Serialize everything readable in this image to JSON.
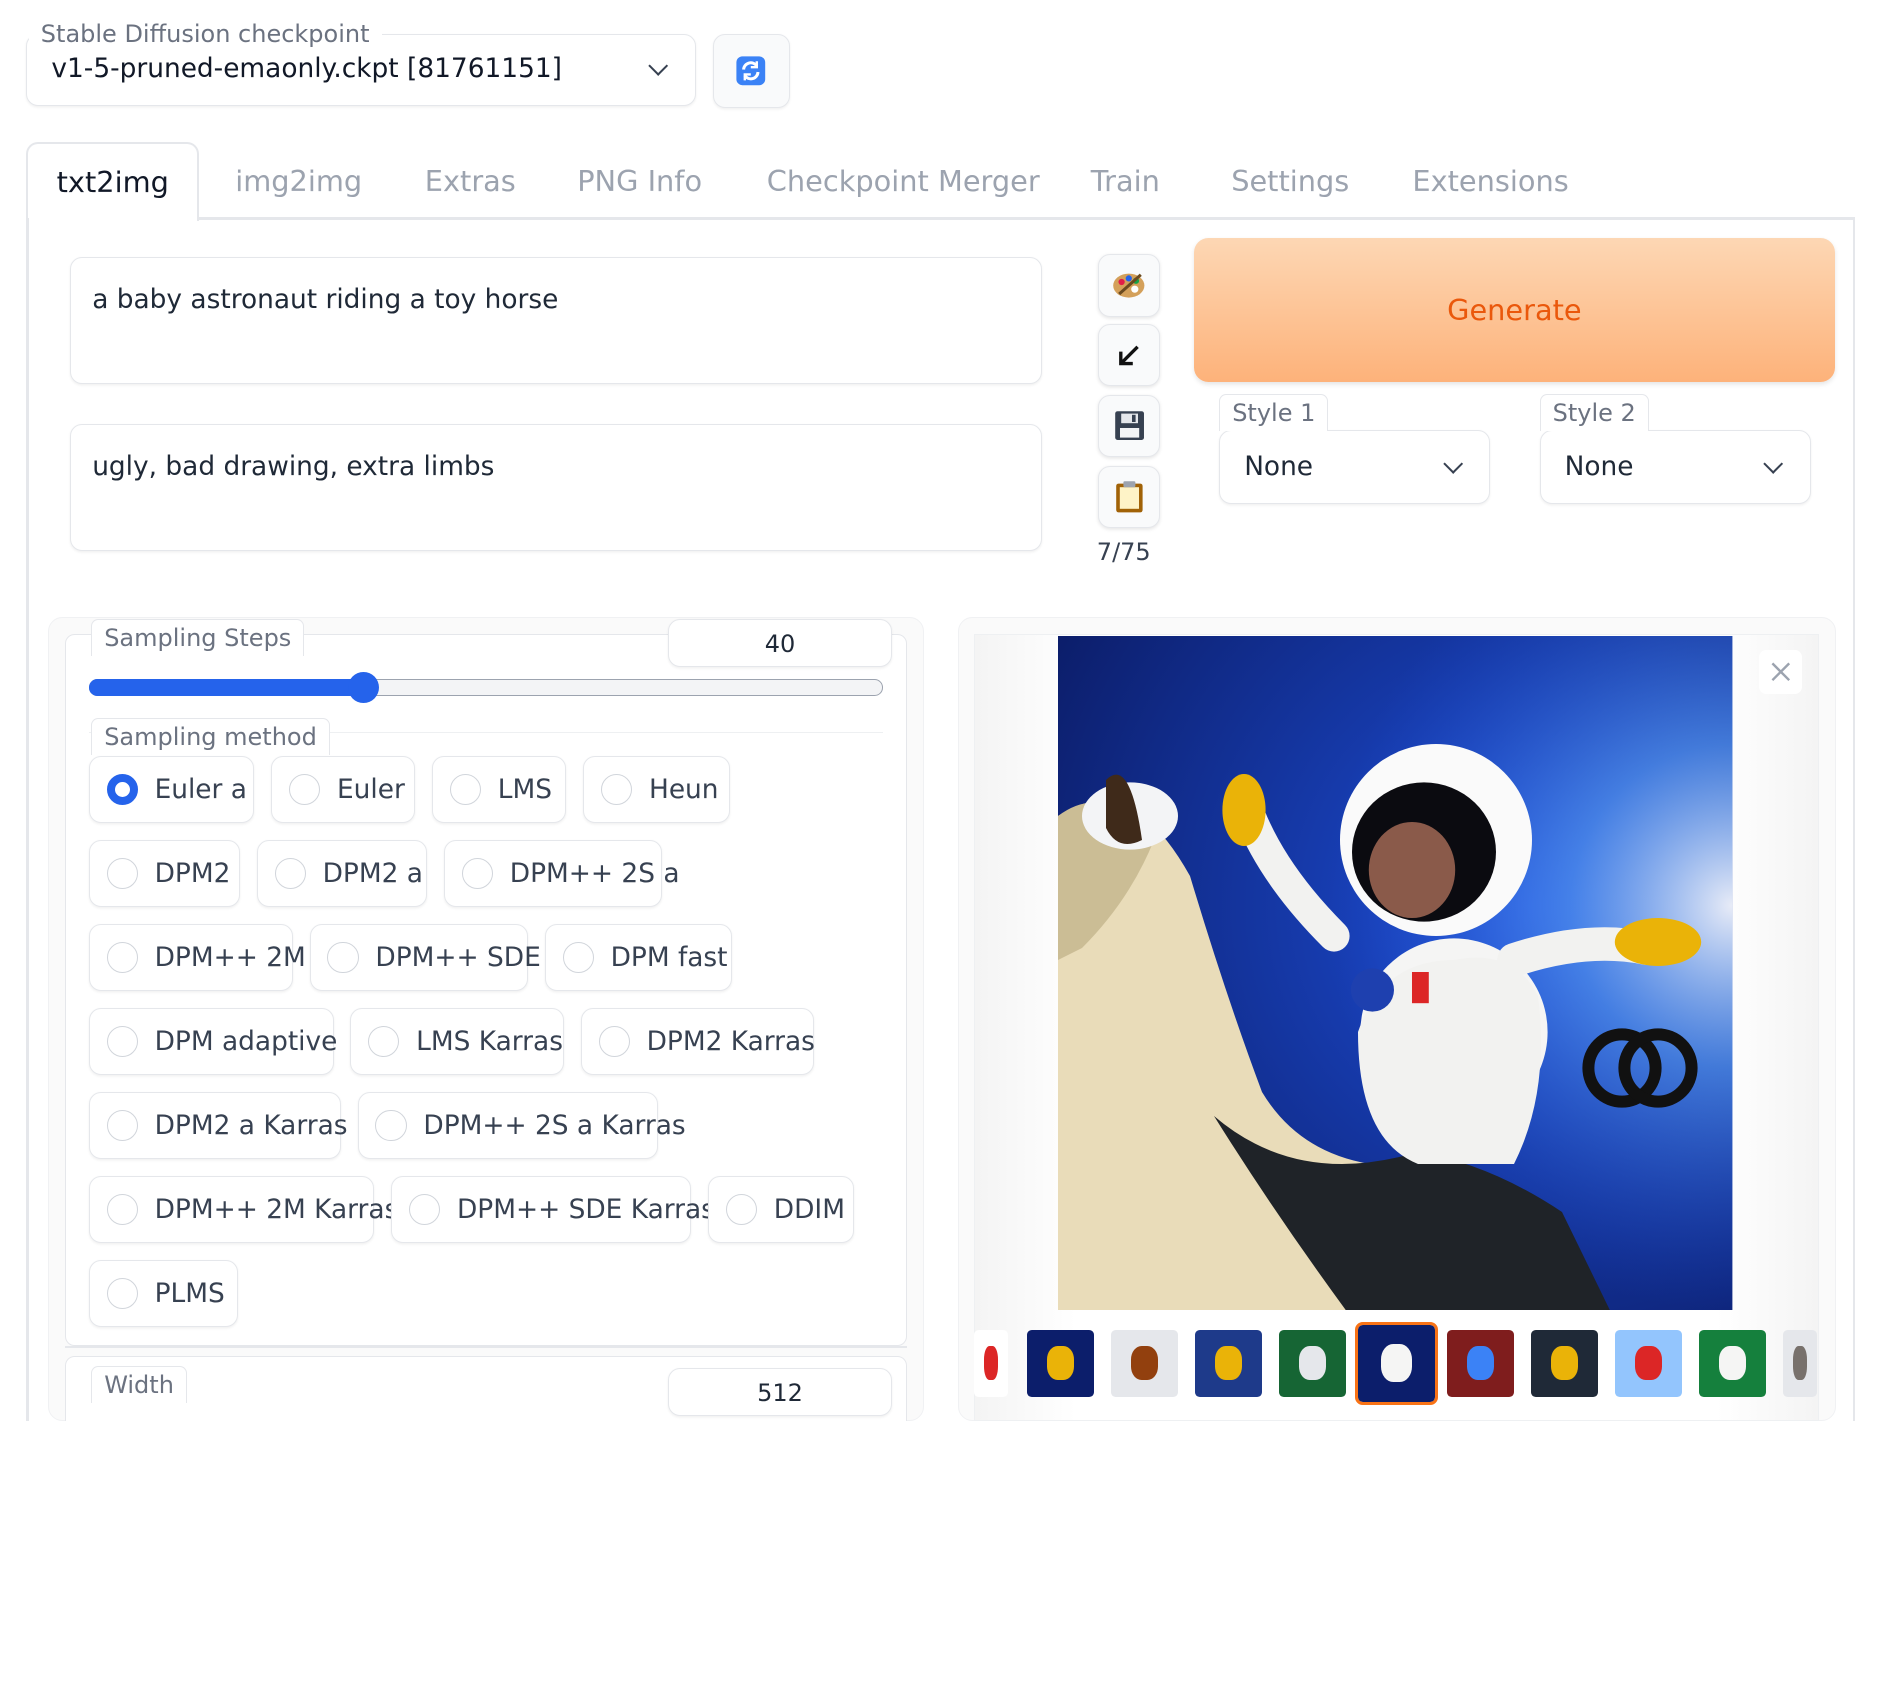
{
  "checkpoint": {
    "label": "Stable Diffusion checkpoint",
    "value": "v1-5-pruned-emaonly.ckpt [81761151]"
  },
  "tabs": [
    "txt2img",
    "img2img",
    "Extras",
    "PNG Info",
    "Checkpoint Merger",
    "Train",
    "Settings",
    "Extensions"
  ],
  "prompt": {
    "positive": "a baby astronaut riding a toy horse",
    "negative": "ugly, bad drawing, extra limbs",
    "token_count": "7/75"
  },
  "generate_label": "Generate",
  "style1": {
    "label": "Style 1",
    "value": "None"
  },
  "style2": {
    "label": "Style 2",
    "value": "None"
  },
  "sampling_steps": {
    "label": "Sampling Steps",
    "value": "40",
    "min": 1,
    "max": 150,
    "current": 40
  },
  "sampling_method": {
    "label": "Sampling method",
    "selected": "Euler a",
    "options": [
      "Euler a",
      "Euler",
      "LMS",
      "Heun",
      "DPM2",
      "DPM2 a",
      "DPM++ 2S a",
      "DPM++ 2M",
      "DPM++ SDE",
      "DPM fast",
      "DPM adaptive",
      "LMS Karras",
      "DPM2 Karras",
      "DPM2 a Karras",
      "DPM++ 2S a Karras",
      "DPM++ 2M Karras",
      "DPM++ SDE Karras",
      "DDIM",
      "PLMS"
    ]
  },
  "width": {
    "label": "Width",
    "value": "512"
  },
  "gallery": {
    "selected_index": 5,
    "thumbnail_count": 11
  }
}
